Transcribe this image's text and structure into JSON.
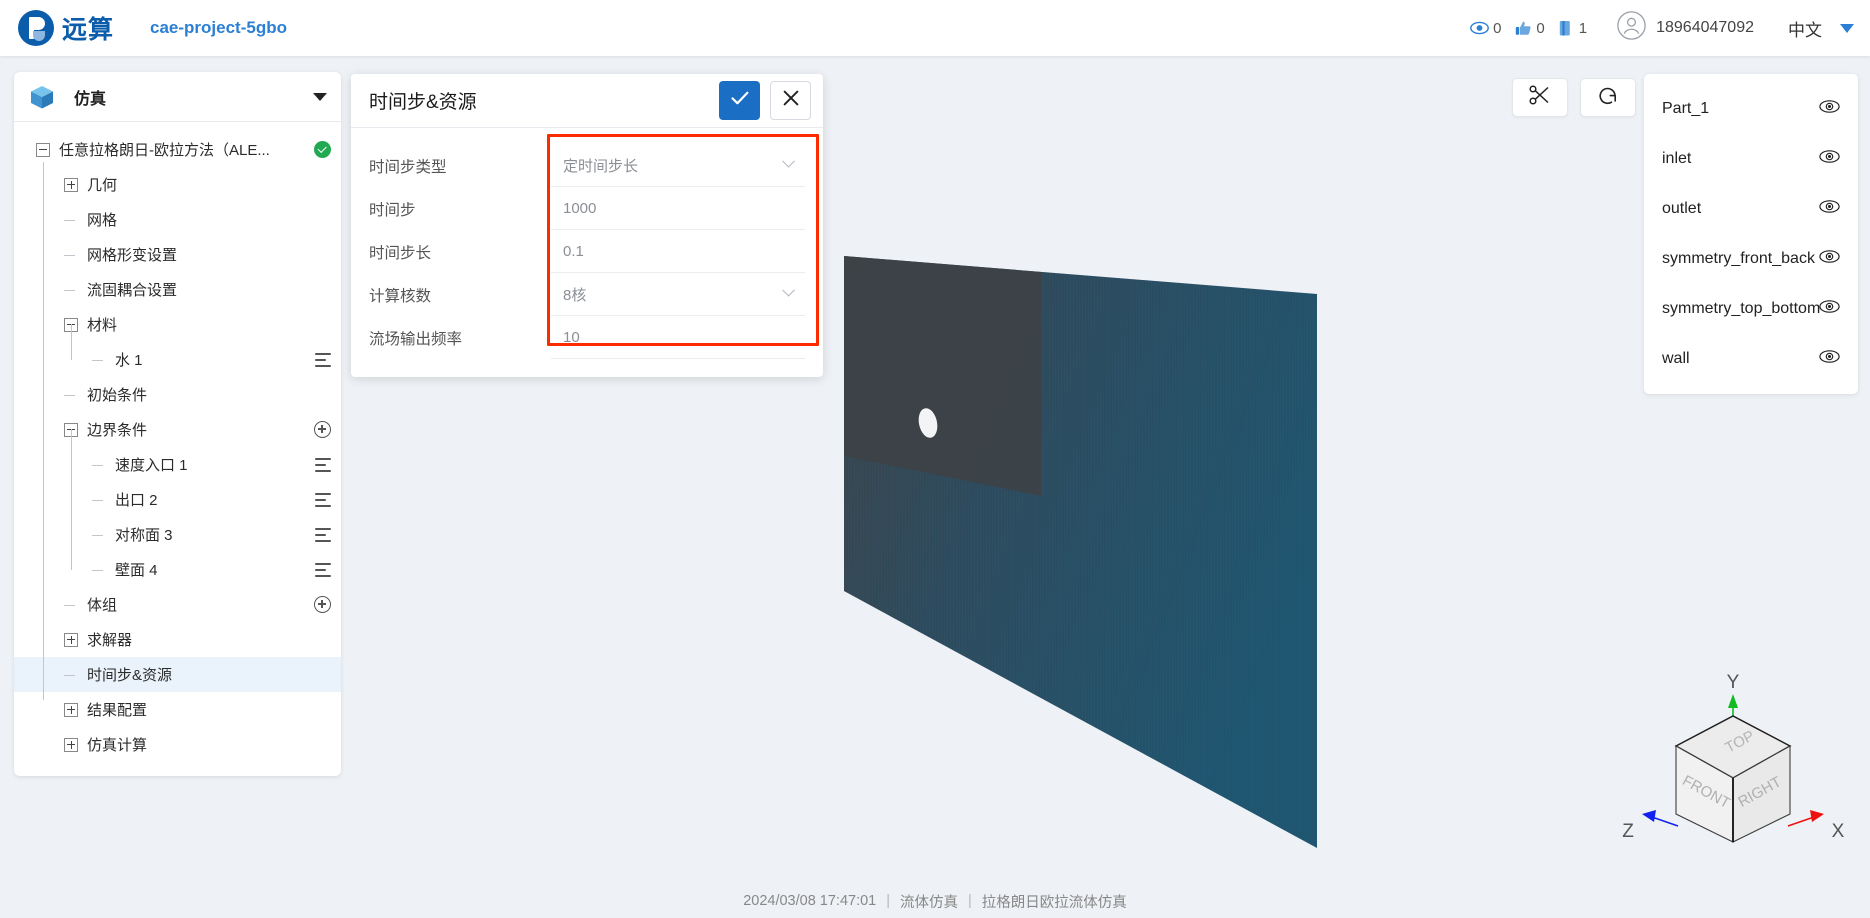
{
  "topbar": {
    "brand": "远算",
    "project": "cae-project-5gbo",
    "stats": [
      {
        "icon": "eye-icon",
        "value": "0"
      },
      {
        "icon": "thumbs-up-icon",
        "value": "0"
      },
      {
        "icon": "copy-icon",
        "value": "1"
      }
    ],
    "user": "18964047092",
    "language": "中文"
  },
  "sidebar": {
    "title": "仿真",
    "tree": [
      {
        "label": "任意拉格朗日-欧拉方法（ALE...",
        "toggle": "minus",
        "indent": 0,
        "status": "ok"
      },
      {
        "label": "几何",
        "toggle": "plus",
        "indent": 1
      },
      {
        "label": "网格",
        "toggle": "stub",
        "indent": 1
      },
      {
        "label": "网格形变设置",
        "toggle": "stub",
        "indent": 1
      },
      {
        "label": "流固耦合设置",
        "toggle": "stub",
        "indent": 1
      },
      {
        "label": "材料",
        "toggle": "minus",
        "indent": 1
      },
      {
        "label": "水 1",
        "toggle": "stub",
        "indent": 2,
        "action": "menu"
      },
      {
        "label": "初始条件",
        "toggle": "stub",
        "indent": 1
      },
      {
        "label": "边界条件",
        "toggle": "minus",
        "indent": 1,
        "action": "plus"
      },
      {
        "label": "速度入口 1",
        "toggle": "stub",
        "indent": 2,
        "action": "menu"
      },
      {
        "label": "出口 2",
        "toggle": "stub",
        "indent": 2,
        "action": "menu"
      },
      {
        "label": "对称面 3",
        "toggle": "stub",
        "indent": 2,
        "action": "menu"
      },
      {
        "label": "壁面 4",
        "toggle": "stub",
        "indent": 2,
        "action": "menu"
      },
      {
        "label": "体组",
        "toggle": "stub",
        "indent": 1,
        "action": "plus"
      },
      {
        "label": "求解器",
        "toggle": "plus",
        "indent": 1
      },
      {
        "label": "时间步&资源",
        "toggle": "stub",
        "indent": 1,
        "selected": true
      },
      {
        "label": "结果配置",
        "toggle": "plus",
        "indent": 1
      },
      {
        "label": "仿真计算",
        "toggle": "plus",
        "indent": 1
      }
    ]
  },
  "dialog": {
    "title": "时间步&资源",
    "confirm_label": "确认",
    "cancel_label": "取消",
    "fields": [
      {
        "label": "时间步类型",
        "value": "定时间步长",
        "type": "select"
      },
      {
        "label": "时间步",
        "value": "1000",
        "type": "input"
      },
      {
        "label": "时间步长",
        "value": "0.1",
        "type": "input"
      },
      {
        "label": "计算核数",
        "value": "8核",
        "type": "select"
      },
      {
        "label": "流场输出频率",
        "value": "10",
        "type": "input"
      }
    ],
    "highlight_color": "#fc2b00"
  },
  "viewport": {
    "tools": [
      {
        "name": "scissors-icon",
        "label": "剪切"
      },
      {
        "name": "reset-view-icon",
        "label": "重置视角"
      }
    ],
    "parts": [
      {
        "name": "Part_1"
      },
      {
        "name": "inlet"
      },
      {
        "name": "outlet"
      },
      {
        "name": "symmetry_front_back"
      },
      {
        "name": "symmetry_top_bottom"
      },
      {
        "name": "wall"
      }
    ],
    "axis": {
      "x_label": "X",
      "y_label": "Y",
      "z_label": "Z",
      "faces": [
        "TOP",
        "FRONT",
        "RIGHT"
      ],
      "x_color": "#ee1111",
      "y_color": "#11bb22",
      "z_color": "#1122ee"
    },
    "model_color": "#2a5c79",
    "background": "#eef1f5"
  },
  "footer": {
    "timestamp": "2024/03/08  17:47:01",
    "category": "流体仿真",
    "case": "拉格朗日欧拉流体仿真"
  }
}
